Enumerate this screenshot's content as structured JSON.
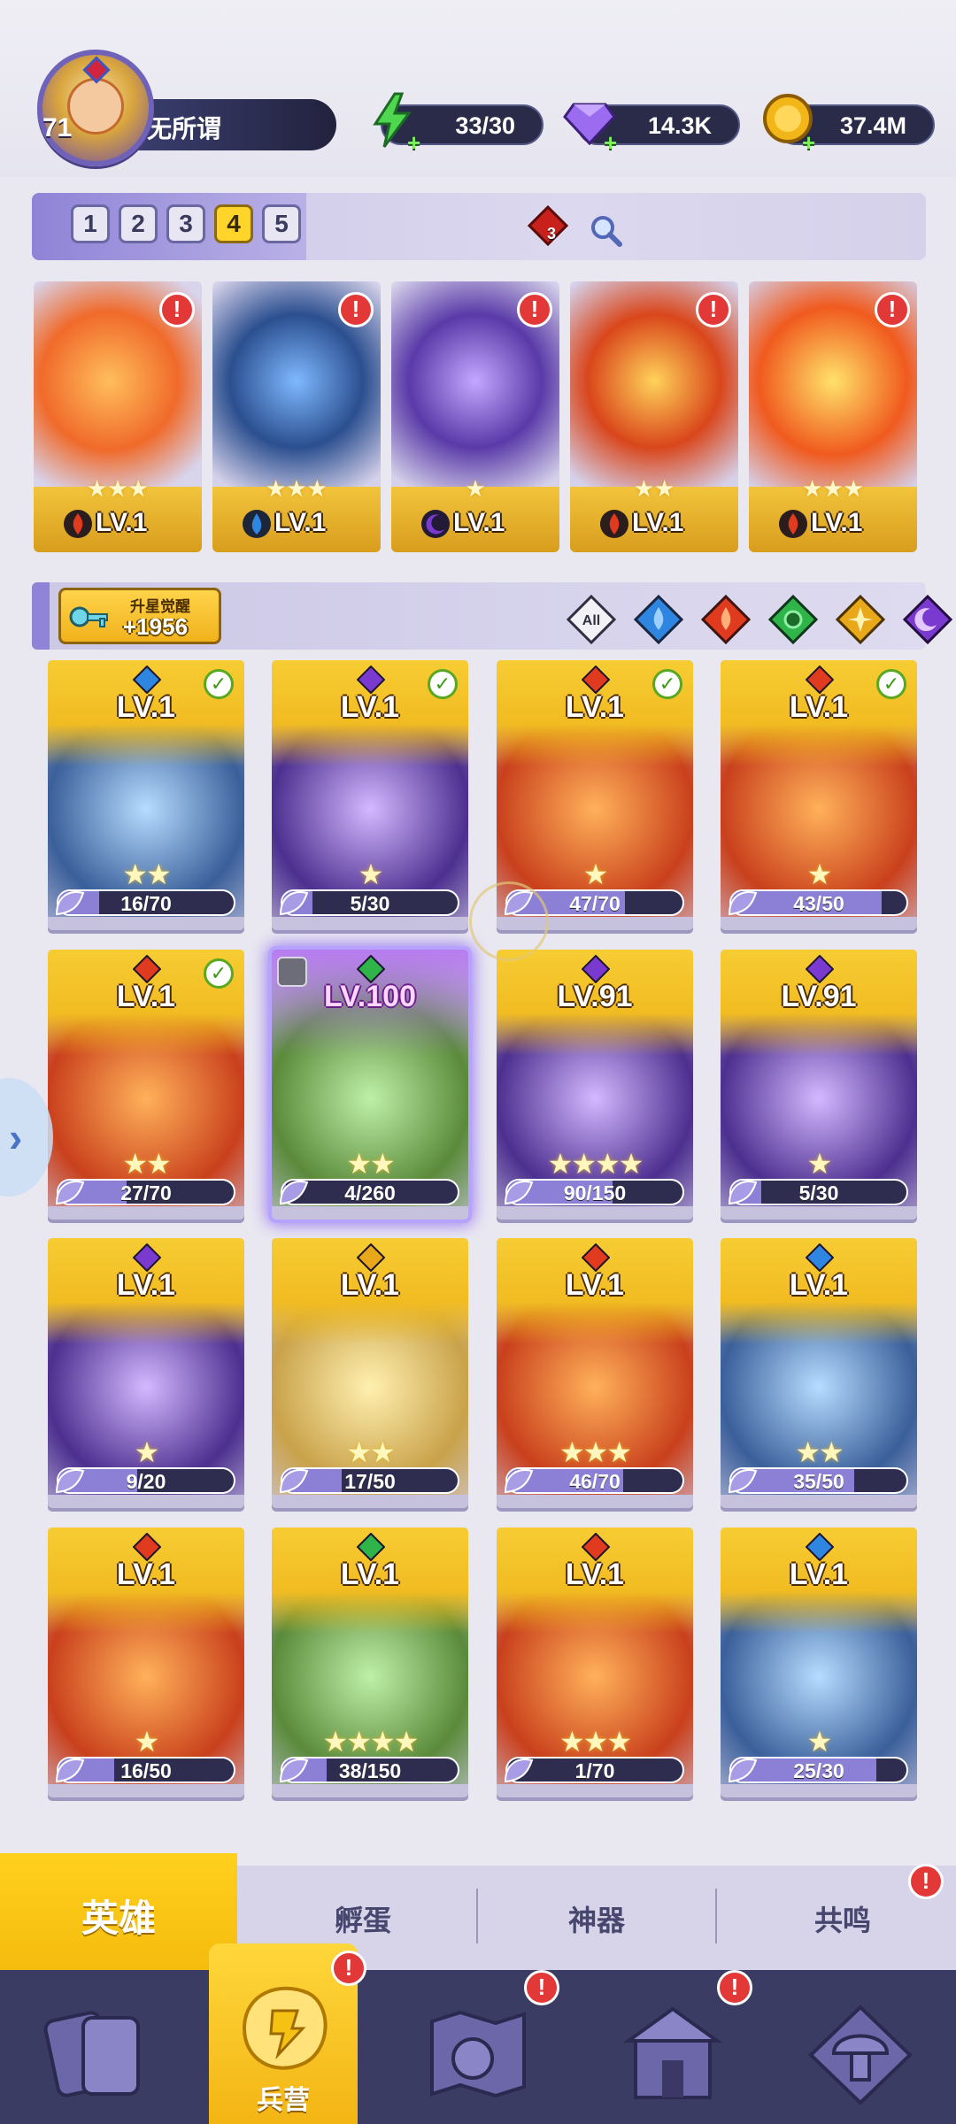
{
  "player": {
    "level": "71",
    "name": "无所谓"
  },
  "resources": [
    {
      "name": "energy",
      "value": "33/30",
      "icon": "lightning-icon",
      "color": "#4fd84f"
    },
    {
      "name": "gems",
      "value": "14.3K",
      "icon": "diamond-icon",
      "color": "#9b6cf0"
    },
    {
      "name": "gold",
      "value": "37.4M",
      "icon": "coin-icon",
      "color": "#f2b619"
    }
  ],
  "team": {
    "tabs": [
      "1",
      "2",
      "3",
      "4",
      "5"
    ],
    "active_tab": "4",
    "rune_count": "3"
  },
  "lineup": [
    {
      "level": "LV.1",
      "stars": 3,
      "element": "fire"
    },
    {
      "level": "LV.1",
      "stars": 3,
      "element": "water"
    },
    {
      "level": "LV.1",
      "stars": 1,
      "element": "dark"
    },
    {
      "level": "LV.1",
      "stars": 2,
      "element": "fire"
    },
    {
      "level": "LV.1",
      "stars": 3,
      "element": "fire"
    }
  ],
  "awaken": {
    "label": "升星觉醒",
    "value": "+1956"
  },
  "filters": {
    "all_label": "All",
    "elements": [
      "water",
      "fire",
      "nature",
      "light",
      "dark"
    ]
  },
  "heroes": [
    {
      "level": "LV.1",
      "element": "water",
      "shards": "16/70",
      "progress": 0.23,
      "stars": 2,
      "ready": true
    },
    {
      "level": "LV.1",
      "element": "dark",
      "shards": "5/30",
      "progress": 0.17,
      "stars": 1,
      "ready": true
    },
    {
      "level": "LV.1",
      "element": "fire",
      "shards": "47/70",
      "progress": 0.67,
      "stars": 1,
      "ready": true
    },
    {
      "level": "LV.1",
      "element": "fire",
      "shards": "43/50",
      "progress": 0.86,
      "stars": 1,
      "ready": true
    },
    {
      "level": "LV.1",
      "element": "fire",
      "shards": "27/70",
      "progress": 0.39,
      "stars": 2,
      "ready": true
    },
    {
      "level": "LV.100",
      "element": "nature",
      "shards": "4/260",
      "progress": 0.02,
      "stars": 2,
      "ready": false,
      "selected": true
    },
    {
      "level": "LV.91",
      "element": "dark",
      "shards": "90/150",
      "progress": 0.6,
      "stars": 4,
      "ready": false
    },
    {
      "level": "LV.91",
      "element": "dark",
      "shards": "5/30",
      "progress": 0.17,
      "stars": 1,
      "ready": false
    },
    {
      "level": "LV.1",
      "element": "dark",
      "shards": "9/20",
      "progress": 0.45,
      "stars": 1,
      "ready": false
    },
    {
      "level": "LV.1",
      "element": "light",
      "shards": "17/50",
      "progress": 0.34,
      "stars": 2,
      "ready": false
    },
    {
      "level": "LV.1",
      "element": "fire",
      "shards": "46/70",
      "progress": 0.66,
      "stars": 3,
      "ready": false
    },
    {
      "level": "LV.1",
      "element": "water",
      "shards": "35/50",
      "progress": 0.7,
      "stars": 2,
      "ready": false
    },
    {
      "level": "LV.1",
      "element": "fire",
      "shards": "16/50",
      "progress": 0.32,
      "stars": 1,
      "ready": false
    },
    {
      "level": "LV.1",
      "element": "nature",
      "shards": "38/150",
      "progress": 0.25,
      "stars": 4,
      "ready": false
    },
    {
      "level": "LV.1",
      "element": "fire",
      "shards": "1/70",
      "progress": 0.01,
      "stars": 3,
      "ready": false
    },
    {
      "level": "LV.1",
      "element": "water",
      "shards": "25/30",
      "progress": 0.83,
      "stars": 1,
      "ready": false
    }
  ],
  "subtabs": {
    "heroes": "英雄",
    "hatch": "孵蛋",
    "artifacts": "神器",
    "resonance": "共鸣"
  },
  "nav": {
    "barracks": "兵营"
  },
  "colors": {
    "fire": "#e03a1f",
    "water": "#2f86e0",
    "nature": "#2fb44a",
    "light": "#e8a81a",
    "dark": "#7a3ad0",
    "accent": "#f5bc0e"
  }
}
